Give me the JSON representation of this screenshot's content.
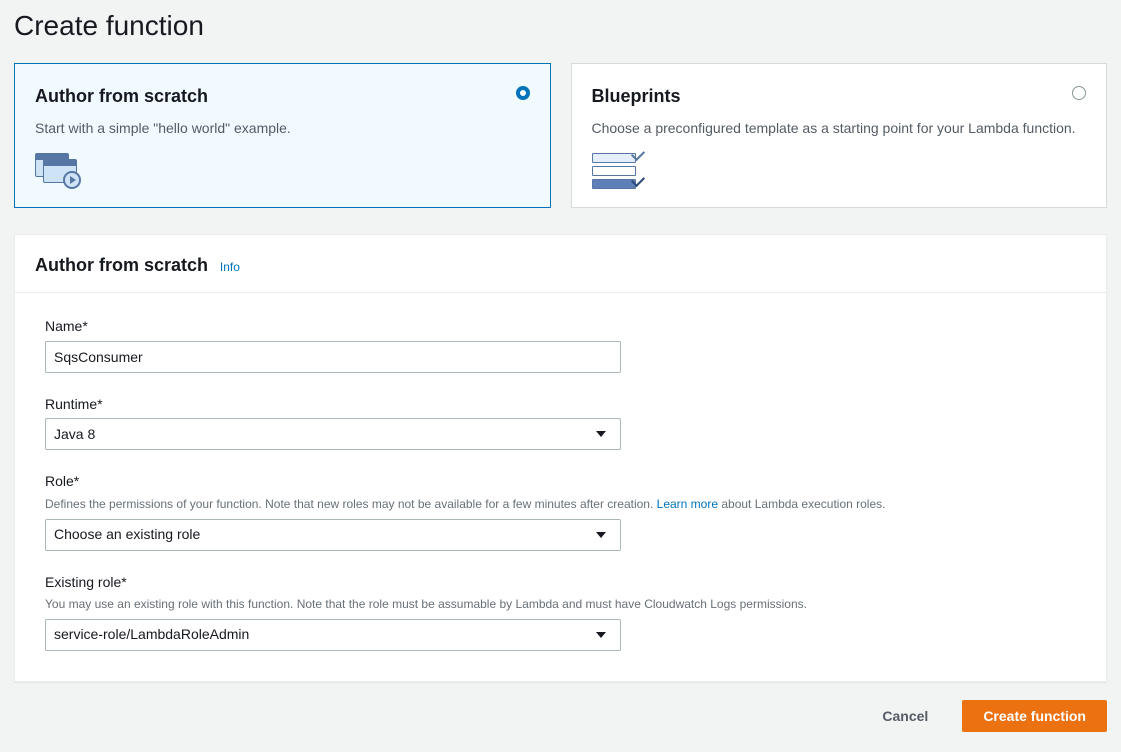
{
  "page_title": "Create function",
  "options": {
    "scratch": {
      "title": "Author from scratch",
      "desc": "Start with a simple \"hello world\" example."
    },
    "blueprints": {
      "title": "Blueprints",
      "desc": "Choose a preconfigured template as a starting point for your Lambda function."
    }
  },
  "panel": {
    "title": "Author from scratch",
    "info": "Info"
  },
  "form": {
    "name": {
      "label": "Name*",
      "value": "SqsConsumer"
    },
    "runtime": {
      "label": "Runtime*",
      "value": "Java 8"
    },
    "role": {
      "label": "Role*",
      "help_pre": "Defines the permissions of your function. Note that new roles may not be available for a few minutes after creation. ",
      "help_link": "Learn more",
      "help_post": " about Lambda execution roles.",
      "value": "Choose an existing role"
    },
    "existing_role": {
      "label": "Existing role*",
      "help": "You may use an existing role with this function. Note that the role must be assumable by Lambda and must have Cloudwatch Logs permissions.",
      "value": "service-role/LambdaRoleAdmin"
    }
  },
  "buttons": {
    "cancel": "Cancel",
    "create": "Create function"
  }
}
